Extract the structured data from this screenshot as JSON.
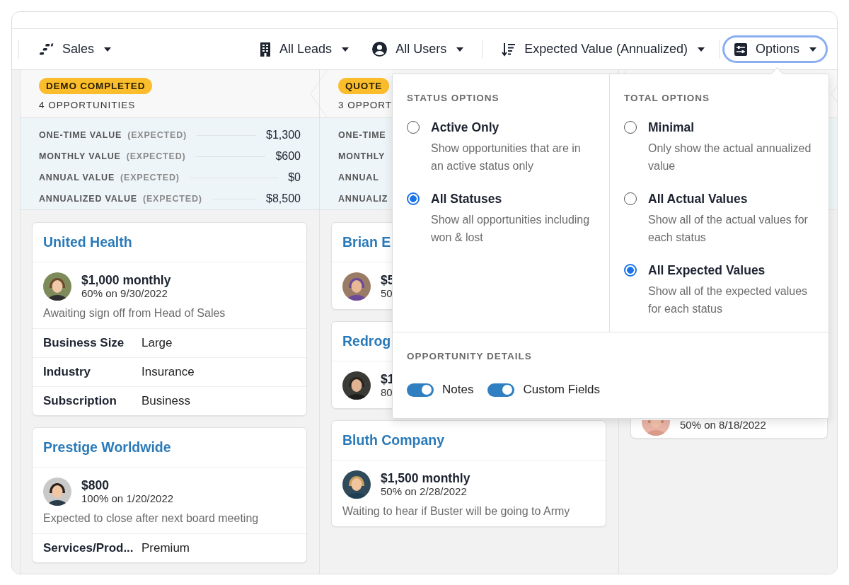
{
  "toolbar": {
    "items": [
      {
        "label": "Sales",
        "active": false
      },
      {
        "label": "All Leads",
        "active": false
      },
      {
        "label": "All Users",
        "active": false
      },
      {
        "label": "Expected Value (Annualized)",
        "active": false
      },
      {
        "label": "Options",
        "active": true
      }
    ]
  },
  "columns": [
    {
      "stage": "DEMO COMPLETED",
      "count": "4 OPPORTUNITIES",
      "summary": [
        {
          "label": "ONE-TIME VALUE",
          "qualifier": "(EXPECTED)",
          "value": "$1,300"
        },
        {
          "label": "MONTHLY VALUE",
          "qualifier": "(EXPECTED)",
          "value": "$600"
        },
        {
          "label": "ANNUAL VALUE",
          "qualifier": "(EXPECTED)",
          "value": "$0"
        },
        {
          "label": "ANNUALIZED VALUE",
          "qualifier": "(EXPECTED)",
          "value": "$8,500"
        }
      ],
      "cards": [
        {
          "name": "United Health",
          "amount": "$1,000 monthly",
          "probability": "60% on 9/30/2022",
          "note": "Awaiting sign off from Head of Sales",
          "fields": [
            {
              "label": "Business Size",
              "value": "Large"
            },
            {
              "label": "Industry",
              "value": "Insurance"
            },
            {
              "label": "Subscription",
              "value": "Business"
            }
          ]
        },
        {
          "name": "Prestige Worldwide",
          "amount": "$800",
          "probability": "100% on 1/20/2022",
          "note": "Expected to close after next board meeting",
          "fields": [
            {
              "label": "Services/Prod...",
              "value": "Premium"
            }
          ]
        }
      ]
    },
    {
      "stage": "QUOTE",
      "count": "3 OPPORT",
      "summary": [
        {
          "label": "ONE-TIME"
        },
        {
          "label": "MONTHLY"
        },
        {
          "label": "ANNUAL"
        },
        {
          "label": "ANNUALIZ"
        }
      ],
      "cards": [
        {
          "name": "Brian E",
          "amount": "$5",
          "probability": "50"
        },
        {
          "name": "Redrog",
          "amount": "$1",
          "probability": "80"
        },
        {
          "name": "Bluth Company",
          "amount": "$1,500 monthly",
          "probability": "50% on 2/28/2022",
          "note": "Waiting to hear if Buster will be going to Army"
        }
      ]
    },
    {
      "cards": [
        {
          "probability": "50% on 8/18/2022"
        }
      ]
    }
  ],
  "options_menu": {
    "status_options": {
      "title": "STATUS OPTIONS",
      "options": [
        {
          "label": "Active Only",
          "description": "Show opportunities that are in an active status only",
          "selected": false
        },
        {
          "label": "All Statuses",
          "description": "Show all opportunities including won & lost",
          "selected": true
        }
      ]
    },
    "total_options": {
      "title": "TOTAL OPTIONS",
      "options": [
        {
          "label": "Minimal",
          "description": "Only show the actual annualized value",
          "selected": false
        },
        {
          "label": "All Actual Values",
          "description": "Show all of the actual values for each status",
          "selected": false
        },
        {
          "label": "All Expected Values",
          "description": "Show all of the expected values for each status",
          "selected": true
        }
      ]
    },
    "details": {
      "title": "OPPORTUNITY DETAILS",
      "toggles": [
        {
          "label": "Notes",
          "on": true
        },
        {
          "label": "Custom Fields",
          "on": true
        }
      ]
    }
  }
}
